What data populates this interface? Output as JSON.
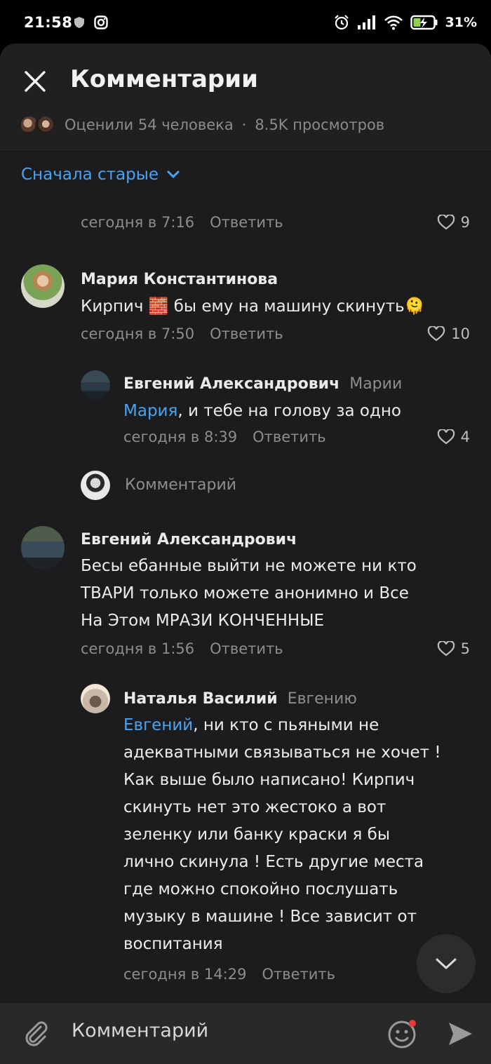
{
  "status_bar": {
    "time": "21:58",
    "battery": "31%",
    "icons": [
      "shield-icon",
      "instagram-icon",
      "alarm-icon",
      "signal-icon",
      "wifi-icon",
      "battery-icon"
    ]
  },
  "header": {
    "title": "Комментарии",
    "rated": "Оценили 54 человека",
    "separator": "·",
    "views": "8.5K просмотров"
  },
  "sort": {
    "label": "Сначала старые"
  },
  "comments": [
    {
      "time": "сегодня в 7:16",
      "reply_label": "Ответить",
      "likes": "9"
    },
    {
      "author": "Мария Константинова",
      "text_before": "Кирпич ",
      "brick_emoji": "🧱",
      "text_after": " бы ему на машину скинуть",
      "face_emoji": "🫠",
      "time": "сегодня в 7:50",
      "reply_label": "Ответить",
      "likes": "10",
      "replies": [
        {
          "author": "Евгений Александрович",
          "to": "Марии",
          "mention": "Мария",
          "text": ", и тебе на голову за одно",
          "time": "сегодня в 8:39",
          "reply_label": "Ответить",
          "likes": "4"
        }
      ],
      "reply_input_placeholder": "Комментарий"
    },
    {
      "author": "Евгений Александрович",
      "lines": [
        "Бесы ебанные выйти не можете ни кто",
        "ТВАРИ только можете анонимно и Все",
        "На Этом МРАЗИ КОНЧЕННЫЕ"
      ],
      "time": "сегодня в 1:56",
      "reply_label": "Ответить",
      "likes": "5",
      "replies": [
        {
          "author": "Наталья Василий",
          "to": "Евгению",
          "mention": "Евгений",
          "first_line_rest": ", ни кто с пьяными не",
          "lines": [
            "адекватными связываться не хочет !",
            "Как выше было написано! Кирпич",
            "скинуть нет это жестоко а вот",
            "зеленку или банку краски я бы",
            "лично скинула ! Есть другие места",
            "где можно спокойно послушать",
            "музыку в машине ! Все зависит от",
            "воспитания"
          ],
          "time": "сегодня в 14:29",
          "reply_label": "Ответить"
        }
      ]
    }
  ],
  "composer": {
    "placeholder": "Комментарий"
  },
  "colors": {
    "accent": "#4aa3f0",
    "sheet_bg": "#1c1c1e",
    "header_bg": "#202022",
    "composer_bg": "#29292b",
    "notification_dot": "#e53935"
  }
}
